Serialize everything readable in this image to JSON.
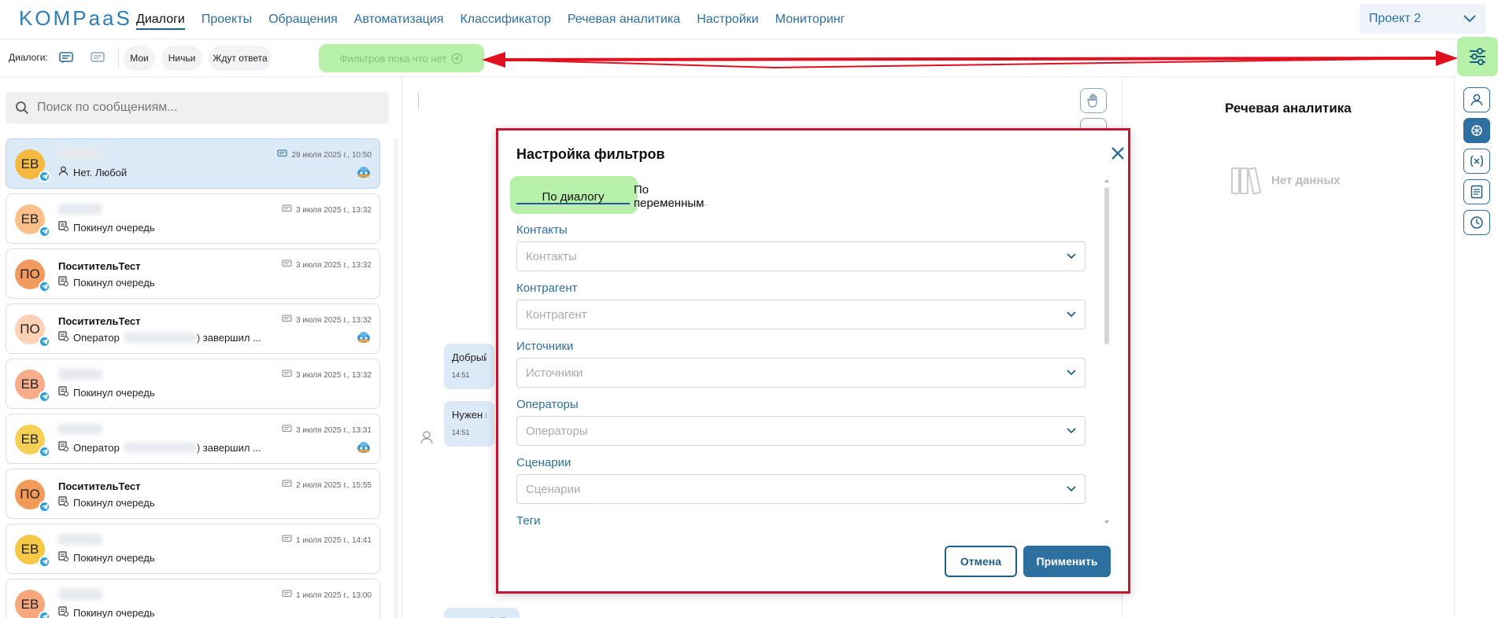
{
  "app": {
    "logo": "KOMPaaS"
  },
  "nav": {
    "items": [
      "Диалоги",
      "Проекты",
      "Обращения",
      "Автоматизация",
      "Классификатор",
      "Речевая аналитика",
      "Настройки",
      "Мониторинг"
    ],
    "active_index": 0
  },
  "project": {
    "selected": "Проект 2"
  },
  "toolbar": {
    "dialogs_label": "Диалоги:",
    "chips": [
      "Мои",
      "Ничьи",
      "Ждут ответа"
    ],
    "filter_chip": "Фильтров пока что нет"
  },
  "search": {
    "placeholder": "Поиск по сообщениям..."
  },
  "dialogs": [
    {
      "avatar": "ЕВ",
      "avatar_color": "#f5b942",
      "name": "",
      "date": "29 июля 2025 г., 10:50",
      "status": "Нет. Любой",
      "status_icon": "user-icon",
      "bot": true,
      "active": true
    },
    {
      "avatar": "ЕВ",
      "avatar_color": "#f9c08a",
      "name": "",
      "date": "3 июля 2025 г., 13:32",
      "status": "Покинул очередь",
      "status_icon": "queue-icon",
      "bot": false,
      "active": false
    },
    {
      "avatar": "ПО",
      "avatar_color": "#f29a60",
      "name": "ПоситительТест",
      "date": "3 июля 2025 г., 13:32",
      "status": "Покинул очередь",
      "status_icon": "queue-icon",
      "bot": false,
      "active": false
    },
    {
      "avatar": "ПО",
      "avatar_color": "#fcd1b5",
      "name": "ПоситительТест",
      "date": "3 июля 2025 г., 13:32",
      "status_prefix": "Оператор",
      "status_suffix": ") завершил ...",
      "status_icon": "queue-icon",
      "bot": true,
      "active": false
    },
    {
      "avatar": "ЕВ",
      "avatar_color": "#f7ac8a",
      "name": "",
      "date": "3 июля 2025 г., 13:32",
      "status": "Покинул очередь",
      "status_icon": "queue-icon",
      "bot": false,
      "active": false
    },
    {
      "avatar": "ЕВ",
      "avatar_color": "#f6d055",
      "name": "",
      "date": "3 июля 2025 г., 13:31",
      "status_prefix": "Оператор",
      "status_suffix": ") завершил ...",
      "status_icon": "queue-icon",
      "bot": true,
      "active": false
    },
    {
      "avatar": "ПО",
      "avatar_color": "#f29a58",
      "name": "ПоситительТест",
      "date": "2 июля 2025 г., 15:55",
      "status": "Покинул очередь",
      "status_icon": "queue-icon",
      "bot": false,
      "active": false
    },
    {
      "avatar": "ЕВ",
      "avatar_color": "#f6c845",
      "name": "",
      "date": "1 июля 2025 г., 14:41",
      "status": "Покинул очередь",
      "status_icon": "queue-icon",
      "bot": false,
      "active": false
    },
    {
      "avatar": "ЕВ",
      "avatar_color": "#f7a77e",
      "name": "",
      "date": "1 июля 2025 г., 13:00",
      "status": "Покинул очередь",
      "status_icon": "queue-icon",
      "bot": false,
      "active": false
    }
  ],
  "chat": {
    "messages": [
      {
        "text": "Добрый...",
        "time": "14:51"
      },
      {
        "text": "Нужен н",
        "time": "14:51"
      },
      {
        "text": "Нет. Любой",
        "time": ""
      }
    ]
  },
  "speech_panel": {
    "title": "Речевая аналитика",
    "empty": "Нет данных"
  },
  "modal": {
    "title": "Настройка фильтров",
    "tabs": [
      "По диалогу",
      "По переменным"
    ],
    "active_tab": 0,
    "fields": [
      {
        "label": "Контакты",
        "placeholder": "Контакты"
      },
      {
        "label": "Контрагент",
        "placeholder": "Контрагент"
      },
      {
        "label": "Источники",
        "placeholder": "Источники"
      },
      {
        "label": "Операторы",
        "placeholder": "Операторы"
      },
      {
        "label": "Сценарии",
        "placeholder": "Сценарии"
      },
      {
        "label": "Теги",
        "placeholder": ""
      }
    ],
    "cancel": "Отмена",
    "apply": "Применить"
  },
  "colors": {
    "accent": "#2d6f9e",
    "highlight": "#b7f0a8",
    "annotation": "#e01020"
  }
}
